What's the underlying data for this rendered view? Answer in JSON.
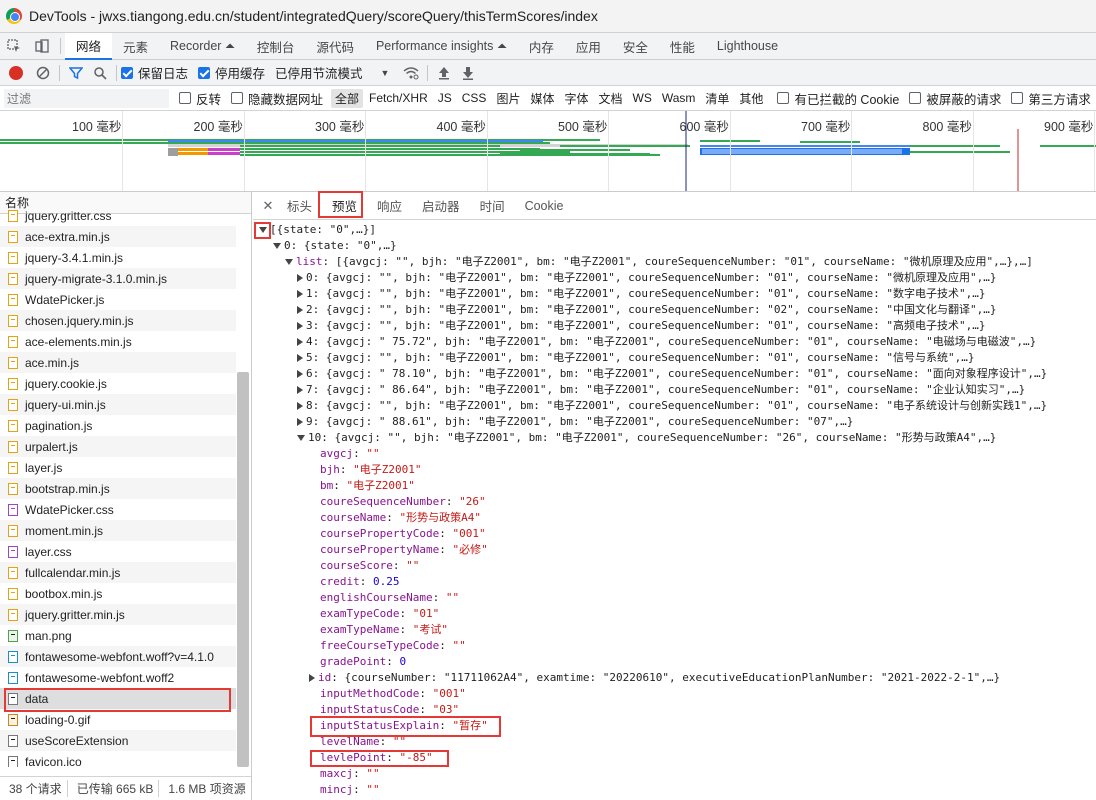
{
  "window": {
    "title": "DevTools - jwxs.tiangong.edu.cn/student/integratedQuery/scoreQuery/thisTermScores/index"
  },
  "devtools_tabs": [
    "网络",
    "元素",
    "Recorder ⏶",
    "控制台",
    "源代码",
    "Performance insights ⏶",
    "内存",
    "应用",
    "安全",
    "性能",
    "Lighthouse"
  ],
  "toolbar": {
    "preserve_log": "保留日志",
    "disable_cache": "停用缓存",
    "throttle": "已停用节流模式"
  },
  "filterbar": {
    "placeholder": "过滤",
    "invert": "反转",
    "hide_data_urls": "隐藏数据网址",
    "types": [
      "全部",
      "Fetch/XHR",
      "JS",
      "CSS",
      "图片",
      "媒体",
      "字体",
      "文档",
      "WS",
      "Wasm",
      "清单",
      "其他"
    ],
    "blocked_cookies": "有已拦截的 Cookie",
    "blocked_requests": "被屏蔽的请求",
    "third_party": "第三方请求"
  },
  "overview": {
    "ticks": [
      "100 毫秒",
      "200 毫秒",
      "300 毫秒",
      "400 毫秒",
      "500 毫秒",
      "600 毫秒",
      "700 毫秒",
      "800 毫秒",
      "900 毫秒"
    ]
  },
  "requests": {
    "header": "名称",
    "files": [
      {
        "name": "jquery.gritter.css",
        "type": "js"
      },
      {
        "name": "ace-extra.min.js",
        "type": "js"
      },
      {
        "name": "jquery-3.4.1.min.js",
        "type": "js"
      },
      {
        "name": "jquery-migrate-3.1.0.min.js",
        "type": "js"
      },
      {
        "name": "WdatePicker.js",
        "type": "js"
      },
      {
        "name": "chosen.jquery.min.js",
        "type": "js"
      },
      {
        "name": "ace-elements.min.js",
        "type": "js"
      },
      {
        "name": "ace.min.js",
        "type": "js"
      },
      {
        "name": "jquery.cookie.js",
        "type": "js"
      },
      {
        "name": "jquery-ui.min.js",
        "type": "js"
      },
      {
        "name": "pagination.js",
        "type": "js"
      },
      {
        "name": "urpalert.js",
        "type": "js"
      },
      {
        "name": "layer.js",
        "type": "js"
      },
      {
        "name": "bootstrap.min.js",
        "type": "js"
      },
      {
        "name": "WdatePicker.css",
        "type": "css"
      },
      {
        "name": "moment.min.js",
        "type": "js"
      },
      {
        "name": "layer.css",
        "type": "css"
      },
      {
        "name": "fullcalendar.min.js",
        "type": "js"
      },
      {
        "name": "bootbox.min.js",
        "type": "js"
      },
      {
        "name": "jquery.gritter.min.js",
        "type": "js"
      },
      {
        "name": "man.png",
        "type": "img"
      },
      {
        "name": "fontawesome-webfont.woff?v=4.1.0",
        "type": "font"
      },
      {
        "name": "fontawesome-webfont.woff2",
        "type": "font"
      },
      {
        "name": "data",
        "type": "doc"
      },
      {
        "name": "loading-0.gif",
        "type": "gif"
      },
      {
        "name": "useScoreExtension",
        "type": "doc"
      },
      {
        "name": "favicon.ico",
        "type": "doc"
      }
    ],
    "status": {
      "requests": "38 个请求",
      "transferred": "已传输 665 kB",
      "resources": "1.6 MB 项资源"
    }
  },
  "detail_tabs": [
    "标头",
    "预览",
    "响应",
    "启动器",
    "时间",
    "Cookie"
  ],
  "preview": [
    {
      "indent": 0,
      "arrow": "down",
      "segs": [
        [
          "p",
          "[{state: \"0\",…}]"
        ]
      ]
    },
    {
      "indent": 1,
      "arrow": "down",
      "segs": [
        [
          "p",
          "0: {state: \"0\",…}"
        ]
      ]
    },
    {
      "indent": 2,
      "arrow": "down",
      "segs": [
        [
          "k",
          "list"
        ],
        [
          "p",
          ": [{avgcj: \"\", bjh: \"电子Z2001\", bm: \"电子Z2001\", coureSequenceNumber: \"01\", courseName: \"微机原理及应用\",…},…]"
        ]
      ]
    },
    {
      "indent": 3,
      "arrow": "right",
      "segs": [
        [
          "p",
          "0: {avgcj: \"\", bjh: \"电子Z2001\", bm: \"电子Z2001\", coureSequenceNumber: \"01\", courseName: \"微机原理及应用\",…}"
        ]
      ]
    },
    {
      "indent": 3,
      "arrow": "right",
      "segs": [
        [
          "p",
          "1: {avgcj: \"\", bjh: \"电子Z2001\", bm: \"电子Z2001\", coureSequenceNumber: \"01\", courseName: \"数字电子技术\",…}"
        ]
      ]
    },
    {
      "indent": 3,
      "arrow": "right",
      "segs": [
        [
          "p",
          "2: {avgcj: \"\", bjh: \"电子Z2001\", bm: \"电子Z2001\", coureSequenceNumber: \"02\", courseName: \"中国文化与翻译\",…}"
        ]
      ]
    },
    {
      "indent": 3,
      "arrow": "right",
      "segs": [
        [
          "p",
          "3: {avgcj: \"\", bjh: \"电子Z2001\", bm: \"电子Z2001\", coureSequenceNumber: \"01\", courseName: \"高频电子技术\",…}"
        ]
      ]
    },
    {
      "indent": 3,
      "arrow": "right",
      "segs": [
        [
          "p",
          "4: {avgcj: \" 75.72\", bjh: \"电子Z2001\", bm: \"电子Z2001\", coureSequenceNumber: \"01\", courseName: \"电磁场与电磁波\",…}"
        ]
      ]
    },
    {
      "indent": 3,
      "arrow": "right",
      "segs": [
        [
          "p",
          "5: {avgcj: \"\", bjh: \"电子Z2001\", bm: \"电子Z2001\", coureSequenceNumber: \"01\", courseName: \"信号与系统\",…}"
        ]
      ]
    },
    {
      "indent": 3,
      "arrow": "right",
      "segs": [
        [
          "p",
          "6: {avgcj: \" 78.10\", bjh: \"电子Z2001\", bm: \"电子Z2001\", coureSequenceNumber: \"01\", courseName: \"面向对象程序设计\",…}"
        ]
      ]
    },
    {
      "indent": 3,
      "arrow": "right",
      "segs": [
        [
          "p",
          "7: {avgcj: \" 86.64\", bjh: \"电子Z2001\", bm: \"电子Z2001\", coureSequenceNumber: \"01\", courseName: \"企业认知实习\",…}"
        ]
      ]
    },
    {
      "indent": 3,
      "arrow": "right",
      "segs": [
        [
          "p",
          "8: {avgcj: \"\", bjh: \"电子Z2001\", bm: \"电子Z2001\", coureSequenceNumber: \"01\", courseName: \"电子系统设计与创新实践1\",…}"
        ]
      ]
    },
    {
      "indent": 3,
      "arrow": "right",
      "segs": [
        [
          "p",
          "9: {avgcj: \" 88.61\", bjh: \"电子Z2001\", bm: \"电子Z2001\", coureSequenceNumber: \"07\",…}"
        ]
      ]
    },
    {
      "indent": 3,
      "arrow": "down",
      "segs": [
        [
          "p",
          "10: {avgcj: \"\", bjh: \"电子Z2001\", bm: \"电子Z2001\", coureSequenceNumber: \"26\", courseName: \"形势与政策A4\",…}"
        ]
      ]
    },
    {
      "indent": 4,
      "arrow": "",
      "segs": [
        [
          "k",
          "avgcj"
        ],
        [
          "p",
          ": "
        ],
        [
          "s",
          "\"\""
        ]
      ]
    },
    {
      "indent": 4,
      "arrow": "",
      "segs": [
        [
          "k",
          "bjh"
        ],
        [
          "p",
          ": "
        ],
        [
          "s",
          "\"电子Z2001\""
        ]
      ]
    },
    {
      "indent": 4,
      "arrow": "",
      "segs": [
        [
          "k",
          "bm"
        ],
        [
          "p",
          ": "
        ],
        [
          "s",
          "\"电子Z2001\""
        ]
      ]
    },
    {
      "indent": 4,
      "arrow": "",
      "segs": [
        [
          "k",
          "coureSequenceNumber"
        ],
        [
          "p",
          ": "
        ],
        [
          "s",
          "\"26\""
        ]
      ]
    },
    {
      "indent": 4,
      "arrow": "",
      "segs": [
        [
          "k",
          "courseName"
        ],
        [
          "p",
          ": "
        ],
        [
          "s",
          "\"形势与政策A4\""
        ]
      ]
    },
    {
      "indent": 4,
      "arrow": "",
      "segs": [
        [
          "k",
          "coursePropertyCode"
        ],
        [
          "p",
          ": "
        ],
        [
          "s",
          "\"001\""
        ]
      ]
    },
    {
      "indent": 4,
      "arrow": "",
      "segs": [
        [
          "k",
          "coursePropertyName"
        ],
        [
          "p",
          ": "
        ],
        [
          "s",
          "\"必修\""
        ]
      ]
    },
    {
      "indent": 4,
      "arrow": "",
      "segs": [
        [
          "k",
          "courseScore"
        ],
        [
          "p",
          ": "
        ],
        [
          "s",
          "\"\""
        ]
      ]
    },
    {
      "indent": 4,
      "arrow": "",
      "segs": [
        [
          "k",
          "credit"
        ],
        [
          "p",
          ": "
        ],
        [
          "n",
          "0.25"
        ]
      ]
    },
    {
      "indent": 4,
      "arrow": "",
      "segs": [
        [
          "k",
          "englishCourseName"
        ],
        [
          "p",
          ": "
        ],
        [
          "s",
          "\"\""
        ]
      ]
    },
    {
      "indent": 4,
      "arrow": "",
      "segs": [
        [
          "k",
          "examTypeCode"
        ],
        [
          "p",
          ": "
        ],
        [
          "s",
          "\"01\""
        ]
      ]
    },
    {
      "indent": 4,
      "arrow": "",
      "segs": [
        [
          "k",
          "examTypeName"
        ],
        [
          "p",
          ": "
        ],
        [
          "s",
          "\"考试\""
        ]
      ]
    },
    {
      "indent": 4,
      "arrow": "",
      "segs": [
        [
          "k",
          "freeCourseTypeCode"
        ],
        [
          "p",
          ": "
        ],
        [
          "s",
          "\"\""
        ]
      ]
    },
    {
      "indent": 4,
      "arrow": "",
      "segs": [
        [
          "k",
          "gradePoint"
        ],
        [
          "p",
          ": "
        ],
        [
          "n",
          "0"
        ]
      ]
    },
    {
      "indent": 4,
      "arrow": "right",
      "segs": [
        [
          "k",
          "id"
        ],
        [
          "p",
          ": {courseNumber: \"11711062A4\", examtime: \"20220610\", executiveEducationPlanNumber: \"2021-2022-2-1\",…}"
        ]
      ]
    },
    {
      "indent": 4,
      "arrow": "",
      "segs": [
        [
          "k",
          "inputMethodCode"
        ],
        [
          "p",
          ": "
        ],
        [
          "s",
          "\"001\""
        ]
      ]
    },
    {
      "indent": 4,
      "arrow": "",
      "segs": [
        [
          "k",
          "inputStatusCode"
        ],
        [
          "p",
          ": "
        ],
        [
          "s",
          "\"03\""
        ]
      ]
    },
    {
      "indent": 4,
      "arrow": "",
      "segs": [
        [
          "k",
          "inputStatusExplain"
        ],
        [
          "p",
          ": "
        ],
        [
          "s",
          "\"暂存\""
        ]
      ]
    },
    {
      "indent": 4,
      "arrow": "",
      "segs": [
        [
          "k",
          "levelName"
        ],
        [
          "p",
          ": "
        ],
        [
          "s",
          "\"\""
        ]
      ]
    },
    {
      "indent": 4,
      "arrow": "",
      "segs": [
        [
          "k",
          "levlePoint"
        ],
        [
          "p",
          ": "
        ],
        [
          "s",
          "\"-85\""
        ]
      ]
    },
    {
      "indent": 4,
      "arrow": "",
      "segs": [
        [
          "k",
          "maxcj"
        ],
        [
          "p",
          ": "
        ],
        [
          "s",
          "\"\""
        ]
      ]
    },
    {
      "indent": 4,
      "arrow": "",
      "segs": [
        [
          "k",
          "mincj"
        ],
        [
          "p",
          ": "
        ],
        [
          "s",
          "\"\""
        ]
      ]
    }
  ],
  "colors": {
    "highlight_box": "#e53935",
    "accent": "#1a73e8",
    "record": "#d93025"
  }
}
